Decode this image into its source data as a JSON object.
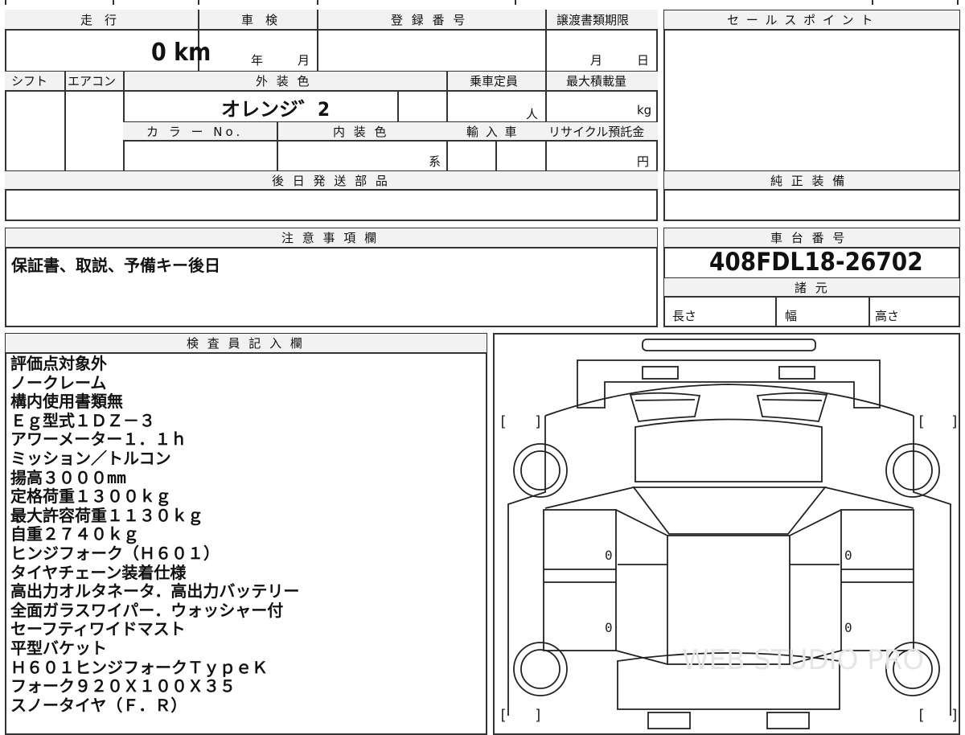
{
  "header": {
    "run": "走　行",
    "inspection": "車　検",
    "registration": "登 録 番 号",
    "transfer_deadline": "譲渡書類期限",
    "sales_point": "セ ー ル ス ポ イ ン ト"
  },
  "values": {
    "mileage": "0 km",
    "year_unit": "年",
    "month_unit": "月",
    "deadline_month": "月",
    "deadline_day": "日"
  },
  "row2": {
    "shift": "シフト",
    "aircon": "エアコン",
    "exterior_color": "外 装 色",
    "capacity": "乗車定員",
    "max_load": "最大積載量",
    "exterior_value": "オレンジ゛2",
    "person_unit": "人",
    "kg_unit": "kg",
    "color_no": "カ ラ ー No.",
    "interior_color": "内 装 色",
    "import": "輸 入 車",
    "recycle": "リサイクル預託金",
    "kei_unit": "系",
    "yen_unit": "円"
  },
  "later_parts": "後 日 発 送 部 品",
  "genuine_equipment": "純 正 装 備",
  "notes_title": "注 意 事 項 欄",
  "notes_text": "保証書、取説、予備キー後日",
  "chassis_title": "車 台 番 号",
  "chassis_number": "408FDL18-26702",
  "specs": {
    "title": "諸 元",
    "length": "長さ",
    "width": "幅",
    "height": "高さ"
  },
  "inspector": {
    "title": "検 査 員 記 入 欄",
    "lines": [
      "評価点対象外",
      "ノークレーム",
      "構内使用書類無",
      "Ｅｇ型式１ＤＺ－３",
      "アワーメーター１．１ｈ",
      "ミッション／トルコン",
      "揚高３０００mm",
      "定格荷重１３００ｋｇ",
      "最大許容荷重１１３０ｋｇ",
      "自重２７４０ｋｇ",
      "ヒンジフォーク（Ｈ６０１）",
      "タイヤチェーン装着仕様",
      "高出力オルタネータ．高出力バッテリー",
      "全面ガラスワイパー．ウォッシャー付",
      "セーフティワイドマスト",
      "平型バケット",
      "Ｈ６０１ヒンジフォークＴｙｐｅＫ",
      "フォーク９２０Ｘ１００Ｘ３５",
      "スノータイヤ（Ｆ．Ｒ）"
    ]
  },
  "diagram": {
    "zeros": [
      "0",
      "0",
      "0",
      "0"
    ],
    "brackets": [
      "[",
      "]",
      "[",
      "]",
      "[",
      "]",
      "[",
      "]"
    ],
    "watermark": "WEB STUDIO PRO"
  }
}
